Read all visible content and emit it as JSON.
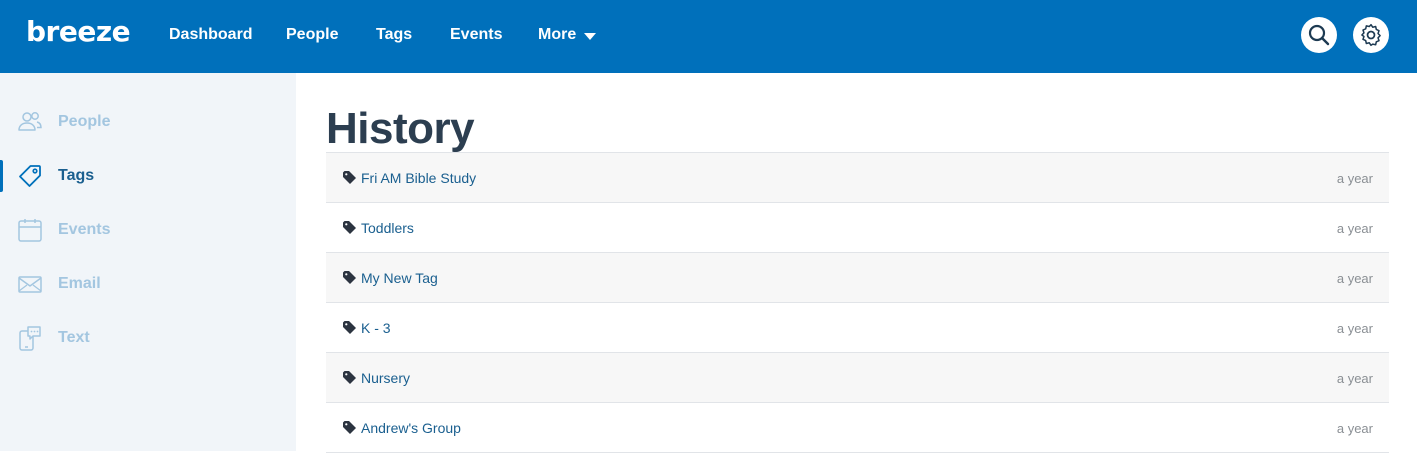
{
  "brand": {
    "logo_text": "breeze",
    "color": "#0070bb"
  },
  "topnav": {
    "links": [
      {
        "label": "Dashboard"
      },
      {
        "label": "People"
      },
      {
        "label": "Tags"
      },
      {
        "label": "Events"
      },
      {
        "label": "More"
      }
    ],
    "search_icon": "search-icon",
    "settings_icon": "gear-icon"
  },
  "sidebar": {
    "items": [
      {
        "label": "People",
        "icon": "people-icon",
        "active": false
      },
      {
        "label": "Tags",
        "icon": "tag-icon",
        "active": true
      },
      {
        "label": "Events",
        "icon": "calendar-icon",
        "active": false
      },
      {
        "label": "Email",
        "icon": "envelope-icon",
        "active": false
      },
      {
        "label": "Text",
        "icon": "phone-chat-icon",
        "active": false
      }
    ]
  },
  "main": {
    "title": "History",
    "history": [
      {
        "name": "Fri AM Bible Study",
        "when": "a year"
      },
      {
        "name": "Toddlers",
        "when": "a year"
      },
      {
        "name": "My New Tag",
        "when": "a year"
      },
      {
        "name": "K - 3",
        "when": "a year"
      },
      {
        "name": "Nursery",
        "when": "a year"
      },
      {
        "name": "Andrew's Group",
        "when": "a year"
      }
    ]
  }
}
